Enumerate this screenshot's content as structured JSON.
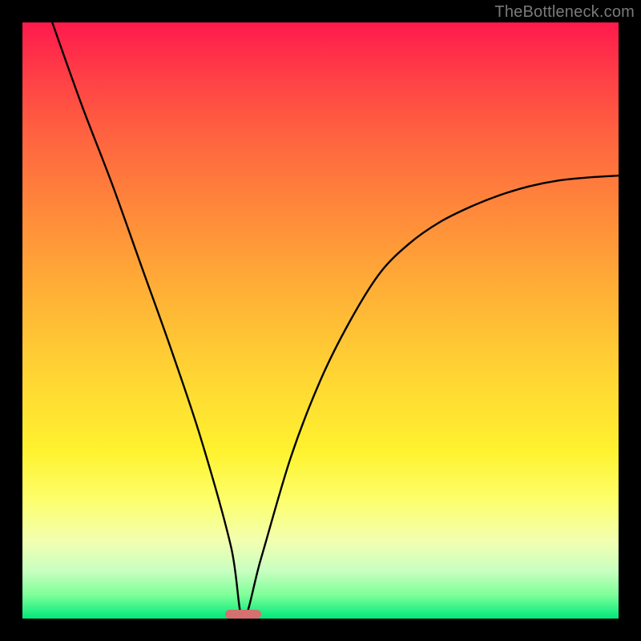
{
  "watermark": "TheBottleneck.com",
  "colors": {
    "frame_bg_top": "#ff1a4d",
    "frame_bg_bottom": "#00e87a",
    "curve_stroke": "#000000",
    "marker_fill": "#d4706f",
    "page_bg": "#000000",
    "watermark_color": "#7a7a7a"
  },
  "chart_data": {
    "type": "line",
    "title": "",
    "xlabel": "",
    "ylabel": "",
    "xlim": [
      0,
      100
    ],
    "ylim": [
      0,
      100
    ],
    "grid": false,
    "legend": false,
    "annotations": [
      "TheBottleneck.com"
    ],
    "series": [
      {
        "name": "curve",
        "x": [
          5,
          10,
          15,
          20,
          25,
          30,
          35,
          37,
          40,
          45,
          50,
          55,
          60,
          65,
          70,
          75,
          80,
          85,
          90,
          95,
          100
        ],
        "y": [
          100,
          86,
          73,
          59,
          45,
          30,
          12,
          0,
          10,
          27,
          40,
          50,
          58,
          63,
          66.5,
          69,
          71,
          72.5,
          73.5,
          74,
          74.3
        ]
      }
    ],
    "marker": {
      "x": 37,
      "y": 0,
      "width_frac": 0.06,
      "height_frac": 0.015
    }
  }
}
